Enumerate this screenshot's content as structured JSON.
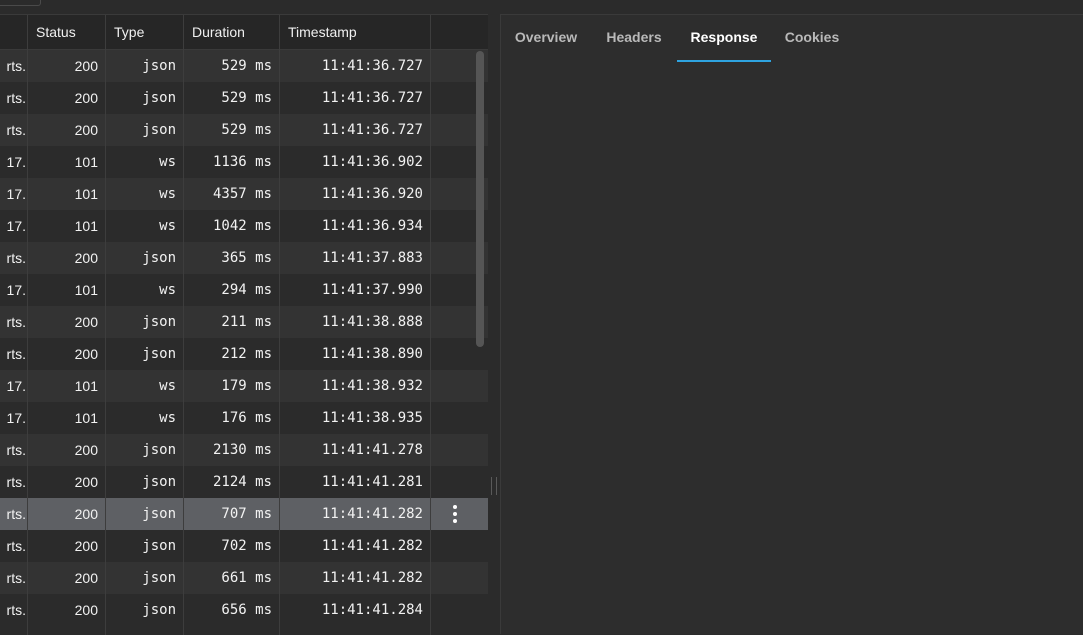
{
  "table": {
    "headers": {
      "status": "Status",
      "type": "Type",
      "duration": "Duration",
      "timestamp": "Timestamp"
    },
    "rows": [
      {
        "name": "rts.",
        "status": "200",
        "type": "json",
        "duration": "529 ms",
        "timestamp": "11:41:36.727"
      },
      {
        "name": "rts.",
        "status": "200",
        "type": "json",
        "duration": "529 ms",
        "timestamp": "11:41:36.727"
      },
      {
        "name": "rts.",
        "status": "200",
        "type": "json",
        "duration": "529 ms",
        "timestamp": "11:41:36.727"
      },
      {
        "name": "17.",
        "status": "101",
        "type": "ws",
        "duration": "1136 ms",
        "timestamp": "11:41:36.902"
      },
      {
        "name": "17.",
        "status": "101",
        "type": "ws",
        "duration": "4357 ms",
        "timestamp": "11:41:36.920"
      },
      {
        "name": "17.",
        "status": "101",
        "type": "ws",
        "duration": "1042 ms",
        "timestamp": "11:41:36.934"
      },
      {
        "name": "rts.",
        "status": "200",
        "type": "json",
        "duration": "365 ms",
        "timestamp": "11:41:37.883"
      },
      {
        "name": "17.",
        "status": "101",
        "type": "ws",
        "duration": "294 ms",
        "timestamp": "11:41:37.990"
      },
      {
        "name": "rts.",
        "status": "200",
        "type": "json",
        "duration": "211 ms",
        "timestamp": "11:41:38.888"
      },
      {
        "name": "rts.",
        "status": "200",
        "type": "json",
        "duration": "212 ms",
        "timestamp": "11:41:38.890"
      },
      {
        "name": "17.",
        "status": "101",
        "type": "ws",
        "duration": "179 ms",
        "timestamp": "11:41:38.932"
      },
      {
        "name": "17.",
        "status": "101",
        "type": "ws",
        "duration": "176 ms",
        "timestamp": "11:41:38.935"
      },
      {
        "name": "rts.",
        "status": "200",
        "type": "json",
        "duration": "2130 ms",
        "timestamp": "11:41:41.278"
      },
      {
        "name": "rts.",
        "status": "200",
        "type": "json",
        "duration": "2124 ms",
        "timestamp": "11:41:41.281"
      },
      {
        "name": "rts.",
        "status": "200",
        "type": "json",
        "duration": "707 ms",
        "timestamp": "11:41:41.282",
        "selected": true
      },
      {
        "name": "rts.",
        "status": "200",
        "type": "json",
        "duration": "702 ms",
        "timestamp": "11:41:41.282"
      },
      {
        "name": "rts.",
        "status": "200",
        "type": "json",
        "duration": "661 ms",
        "timestamp": "11:41:41.282"
      },
      {
        "name": "rts.",
        "status": "200",
        "type": "json",
        "duration": "656 ms",
        "timestamp": "11:41:41.284"
      }
    ],
    "row_menu_icon": "kebab-menu-icon"
  },
  "details": {
    "tabs": [
      {
        "label": "Overview",
        "active": false
      },
      {
        "label": "Headers",
        "active": false
      },
      {
        "label": "Response",
        "active": true
      },
      {
        "label": "Cookies",
        "active": false
      }
    ]
  },
  "colors": {
    "accent": "#2ea3e0",
    "selected_row": "#5e6064"
  }
}
